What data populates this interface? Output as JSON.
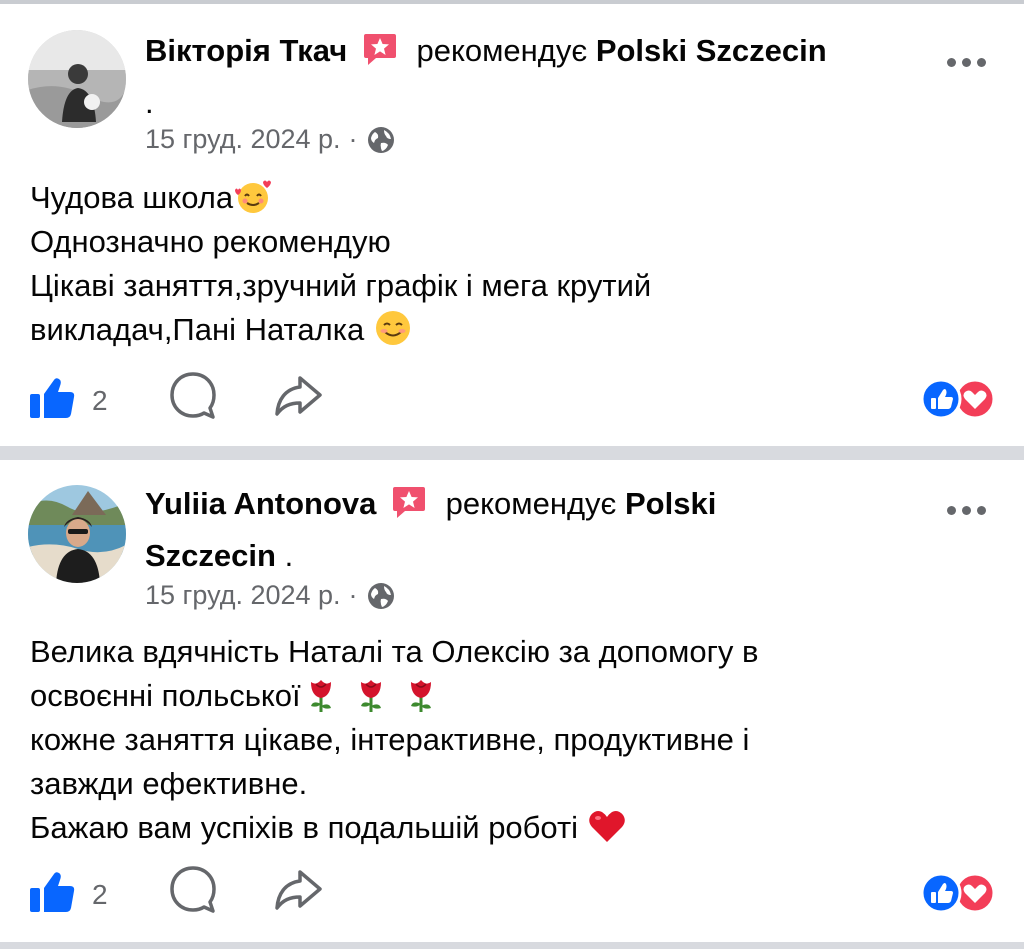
{
  "posts": [
    {
      "author": "Вікторія Ткач",
      "verb": "рекомендує",
      "page": "Polski Szczecin",
      "page_suffix": ".",
      "date": "15 груд. 2024 р.",
      "dot": "·",
      "lines": [
        "Чудова школа",
        "Однозначно рекомендую",
        "Цікаві заняття,зручний графік і мега крутий",
        "викладач,Пані Наталка "
      ],
      "likes": "2"
    },
    {
      "author": "Yuliia Antonova",
      "verb": "рекомендує",
      "page": "Polski",
      "page_line2": "Szczecin",
      "page_suffix": ".",
      "date": "15 груд. 2024 р.",
      "dot": "·",
      "lines": [
        "Велика вдячність Наталі та Олексію за допомогу в",
        "освоєнні польської",
        "кожне заняття цікаве, інтерактивне, продуктивне і",
        "завжди ефективне.",
        "Бажаю вам успіхів в подальшій роботі "
      ],
      "likes": "2"
    }
  ],
  "icons": {
    "badge": "recommend-star-icon",
    "more": "more-options-icon",
    "privacy": "globe-icon",
    "like": "thumbs-up-icon",
    "comment": "comment-icon",
    "share": "share-icon",
    "reactions": "like-love-reactions-icon"
  },
  "colors": {
    "accent_blue": "#0866ff",
    "love_red": "#f33e58",
    "badge_pink": "#f0506e",
    "meta_gray": "#65676b",
    "divider": "#c9ccd1"
  }
}
